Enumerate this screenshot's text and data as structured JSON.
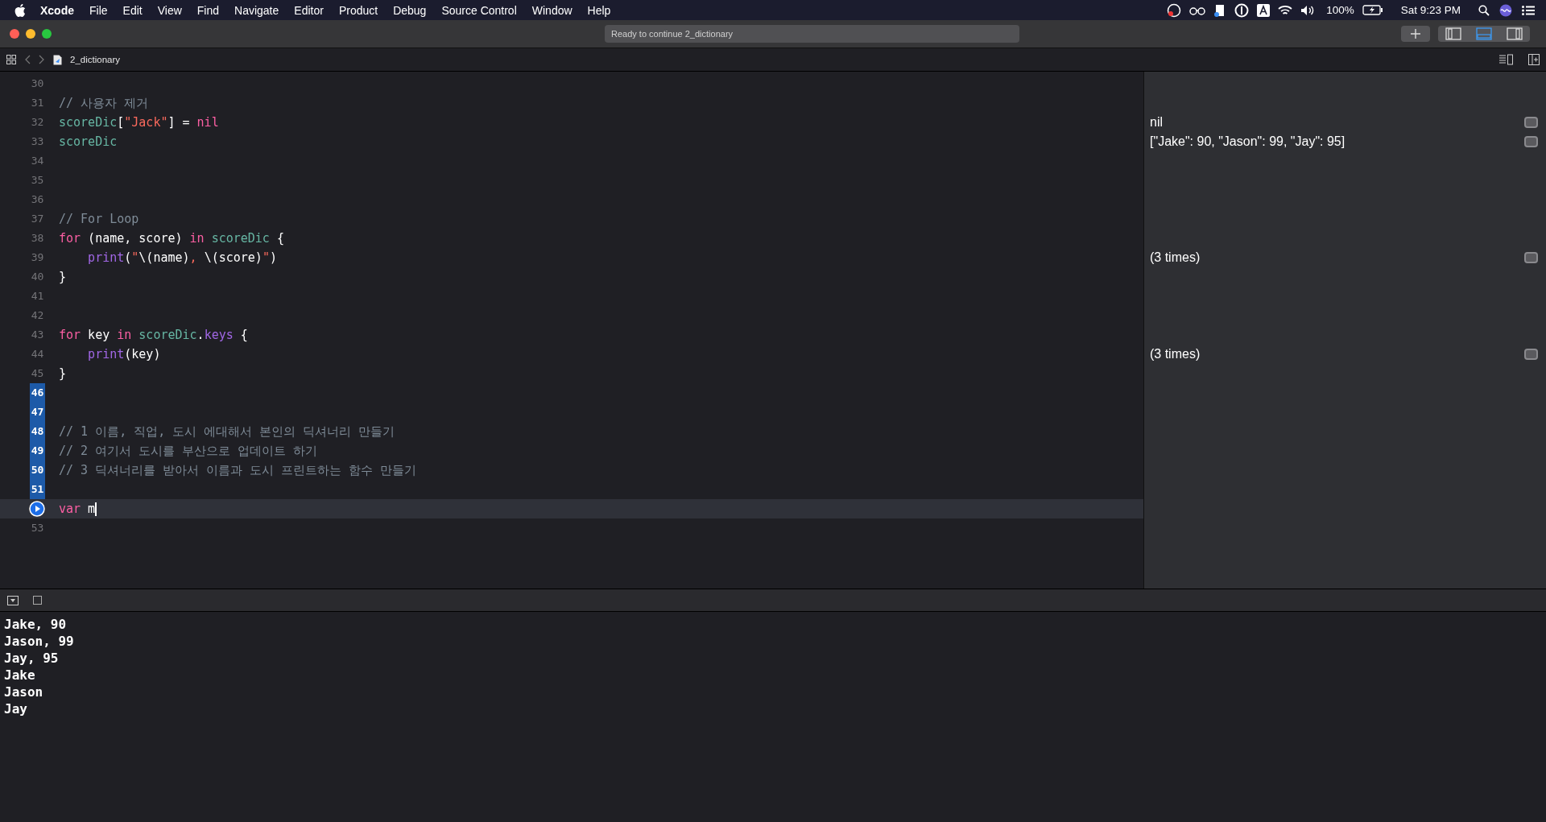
{
  "menu_bar": {
    "app_name": "Xcode",
    "menus": [
      "File",
      "Edit",
      "View",
      "Find",
      "Navigate",
      "Editor",
      "Product",
      "Debug",
      "Source Control",
      "Window",
      "Help"
    ],
    "battery": "100%",
    "clock": "Sat 9:23 PM"
  },
  "toolbar": {
    "status": "Ready to continue 2_dictionary",
    "layout_buttons": [
      {
        "kind": "navigator",
        "selected": false
      },
      {
        "kind": "debug",
        "selected": true
      },
      {
        "kind": "inspector",
        "selected": false
      }
    ]
  },
  "jump_bar": {
    "file": "2_dictionary"
  },
  "editor": {
    "lines": [
      {
        "kind": "numbered",
        "number": "30",
        "selected": false,
        "current": false
      },
      {
        "kind": "numbered",
        "number": "31",
        "selected": false,
        "current": false,
        "tokens": [
          {
            "kind": "comment",
            "text": "// 사용자 제거"
          }
        ]
      },
      {
        "kind": "numbered",
        "number": "32",
        "selected": false,
        "current": false,
        "result": "nil",
        "tokens": [
          {
            "kind": "variable",
            "text": "scoreDic"
          },
          {
            "kind": "plain",
            "text": "["
          },
          {
            "kind": "string",
            "text": "\"Jack\""
          },
          {
            "kind": "plain",
            "text": "] = "
          },
          {
            "kind": "keyword",
            "text": "nil"
          }
        ]
      },
      {
        "kind": "numbered",
        "number": "33",
        "selected": false,
        "current": false,
        "result": "[\"Jake\": 90, \"Jason\": 99, \"Jay\": 95]",
        "tokens": [
          {
            "kind": "variable",
            "text": "scoreDic"
          }
        ]
      },
      {
        "kind": "numbered",
        "number": "34",
        "selected": false,
        "current": false
      },
      {
        "kind": "numbered",
        "number": "35",
        "selected": false,
        "current": false
      },
      {
        "kind": "numbered",
        "number": "36",
        "selected": false,
        "current": false
      },
      {
        "kind": "numbered",
        "number": "37",
        "selected": false,
        "current": false,
        "tokens": [
          {
            "kind": "comment",
            "text": "// For Loop"
          }
        ]
      },
      {
        "kind": "numbered",
        "number": "38",
        "selected": false,
        "current": false,
        "tokens": [
          {
            "kind": "keyword",
            "text": "for"
          },
          {
            "kind": "plain",
            "text": " (name, score) "
          },
          {
            "kind": "keyword",
            "text": "in "
          },
          {
            "kind": "variable",
            "text": "scoreDic"
          },
          {
            "kind": "plain",
            "text": " {"
          }
        ]
      },
      {
        "kind": "numbered",
        "number": "39",
        "selected": false,
        "current": false,
        "result": "(3 times)",
        "tokens": [
          {
            "kind": "function",
            "text": "    print"
          },
          {
            "kind": "plain",
            "text": "("
          },
          {
            "kind": "string",
            "text": "\""
          },
          {
            "kind": "plain",
            "text": "\\(name)"
          },
          {
            "kind": "string",
            "text": ", "
          },
          {
            "kind": "plain",
            "text": "\\(score)"
          },
          {
            "kind": "string",
            "text": "\""
          },
          {
            "kind": "plain",
            "text": ")"
          }
        ]
      },
      {
        "kind": "numbered",
        "number": "40",
        "selected": false,
        "current": false,
        "tokens": [
          {
            "kind": "plain",
            "text": "}"
          }
        ]
      },
      {
        "kind": "numbered",
        "number": "41",
        "selected": false,
        "current": false
      },
      {
        "kind": "numbered",
        "number": "42",
        "selected": false,
        "current": false
      },
      {
        "kind": "numbered",
        "number": "43",
        "selected": false,
        "current": false,
        "tokens": [
          {
            "kind": "keyword",
            "text": "for"
          },
          {
            "kind": "plain",
            "text": " key "
          },
          {
            "kind": "keyword",
            "text": "in "
          },
          {
            "kind": "variable",
            "text": "scoreDic"
          },
          {
            "kind": "plain",
            "text": "."
          },
          {
            "kind": "function",
            "text": "keys"
          },
          {
            "kind": "plain",
            "text": " {"
          }
        ]
      },
      {
        "kind": "numbered",
        "number": "44",
        "selected": false,
        "current": false,
        "result": "(3 times)",
        "tokens": [
          {
            "kind": "function",
            "text": "    print"
          },
          {
            "kind": "plain",
            "text": "(key)"
          }
        ]
      },
      {
        "kind": "numbered",
        "number": "45",
        "selected": false,
        "current": false,
        "tokens": [
          {
            "kind": "plain",
            "text": "}"
          }
        ]
      },
      {
        "kind": "numbered",
        "number": "46",
        "selected": true,
        "current": false
      },
      {
        "kind": "numbered",
        "number": "47",
        "selected": true,
        "current": false
      },
      {
        "kind": "numbered",
        "number": "48",
        "selected": true,
        "current": false,
        "tokens": [
          {
            "kind": "comment",
            "text": "// 1 이름, 직업, 도시 에대해서 본인의 딕셔너리 만들기"
          }
        ]
      },
      {
        "kind": "numbered",
        "number": "49",
        "selected": true,
        "current": false,
        "tokens": [
          {
            "kind": "comment",
            "text": "// 2 여기서 도시를 부산으로 업데이트 하기"
          }
        ]
      },
      {
        "kind": "numbered",
        "number": "50",
        "selected": true,
        "current": false,
        "tokens": [
          {
            "kind": "comment",
            "text": "// 3 딕셔너리를 받아서 이름과 도시 프린트하는 함수 만들기"
          }
        ]
      },
      {
        "kind": "numbered",
        "number": "51",
        "selected": true,
        "current": false
      },
      {
        "kind": "run",
        "current": true,
        "tokens": [
          {
            "kind": "keyword",
            "text": "var"
          },
          {
            "kind": "plain",
            "text": " m"
          }
        ]
      },
      {
        "kind": "numbered",
        "number": "53",
        "selected": false,
        "current": false
      }
    ]
  },
  "console": {
    "lines": [
      "Jake, 90",
      "Jason, 99",
      "Jay, 95",
      "Jake",
      "Jason",
      "Jay"
    ]
  }
}
